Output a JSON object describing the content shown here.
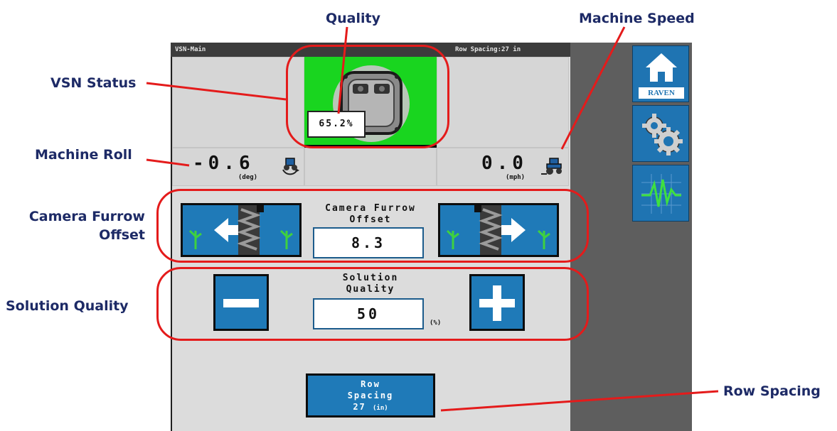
{
  "callouts": {
    "quality": "Quality",
    "machine_speed": "Machine Speed",
    "vsn_status": "VSN Status",
    "machine_roll": "Machine Roll",
    "camera_furrow_offset_line1": "Camera Furrow",
    "camera_furrow_offset_line2": "Offset",
    "solution_quality": "Solution Quality",
    "row_spacing": "Row Spacing"
  },
  "titlebar": {
    "screen_name": "VSN-Main",
    "row_spacing_readout": "Row Spacing:27 in"
  },
  "status": {
    "quality_percent": "65.2%",
    "status_color": "#19d51f"
  },
  "roll": {
    "value": "-0.6",
    "unit": "(deg)"
  },
  "speed": {
    "value": "0.0",
    "unit": "(mph)"
  },
  "furrow": {
    "label_line1": "Camera Furrow",
    "label_line2": "Offset",
    "value": "8.3"
  },
  "solution": {
    "label_line1": "Solution",
    "label_line2": "Quality",
    "value": "50",
    "unit": "(%)"
  },
  "row_spacing_button": {
    "line1": "Row",
    "line2": "Spacing",
    "value": "27",
    "unit": "(in)"
  },
  "sidebar": {
    "home_brand": "RAVEN",
    "icons": [
      "home-icon",
      "gear-icon",
      "diagnostics-icon"
    ]
  },
  "colors": {
    "callout_text": "#1d2a66",
    "callout_ring": "#e41b1b",
    "button_blue": "#1f7ab8",
    "status_green": "#19d51f"
  }
}
